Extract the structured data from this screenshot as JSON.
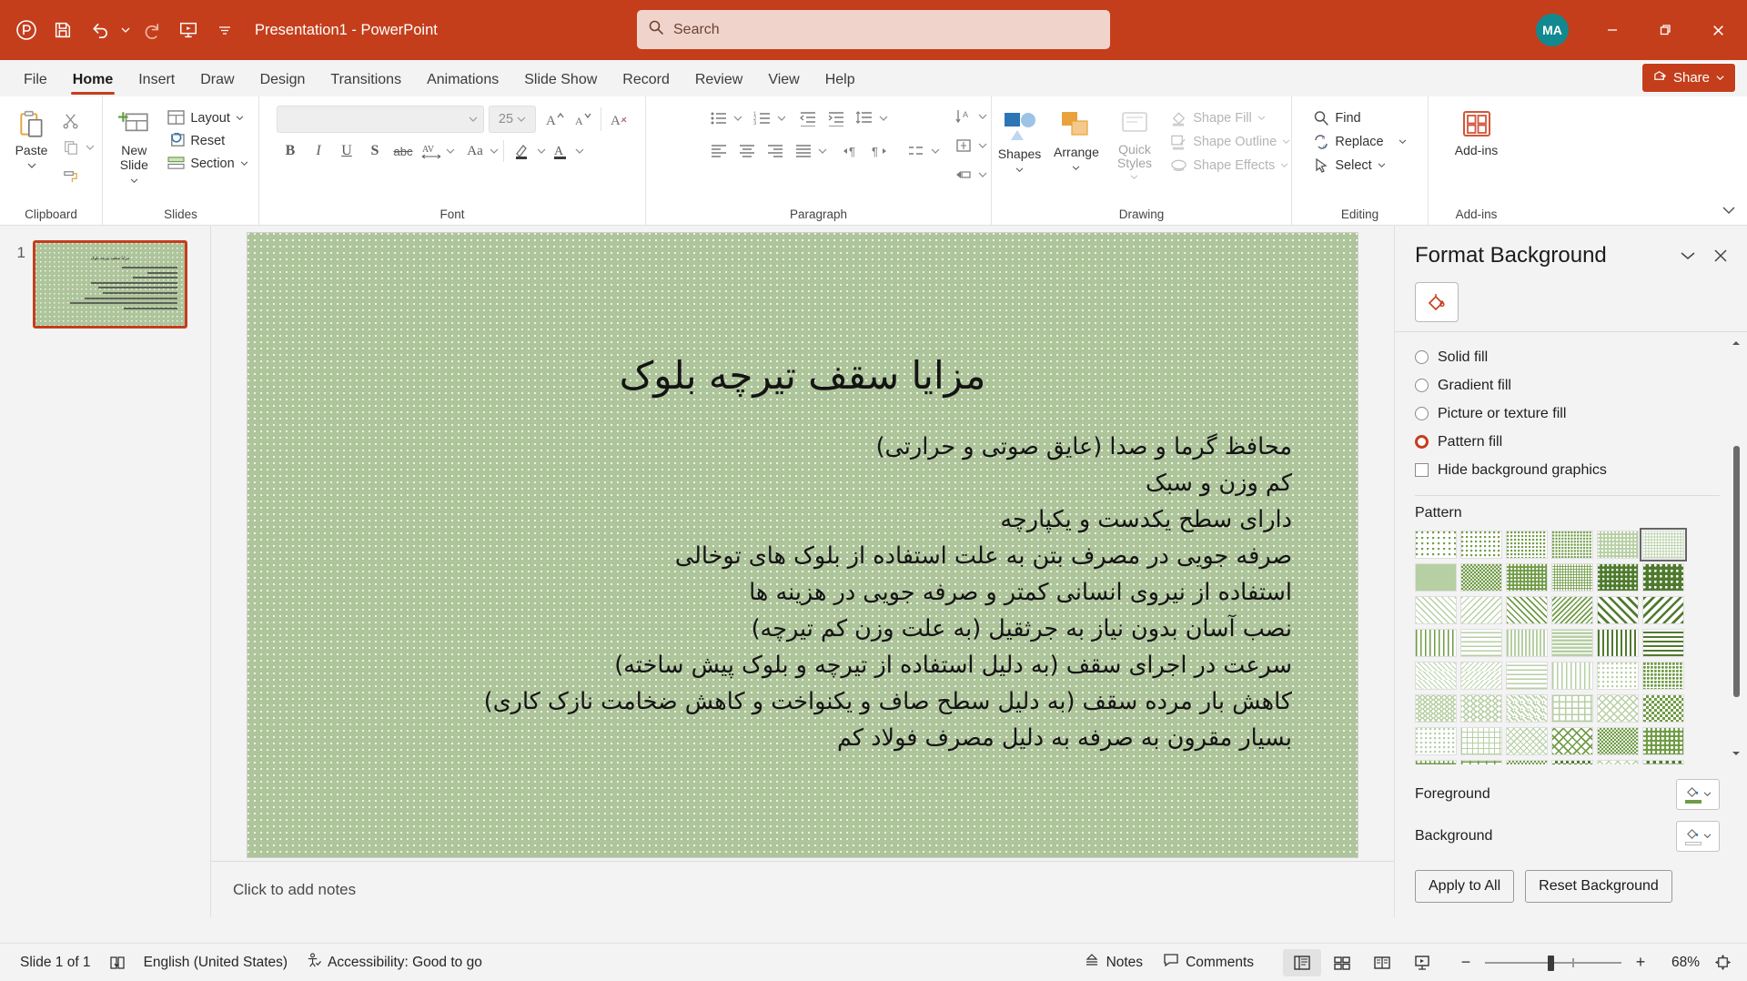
{
  "titlebar": {
    "app_title": "Presentation1  -  PowerPoint",
    "quick_access": [
      {
        "name": "powerpoint-logo-icon",
        "label": "PowerPoint"
      },
      {
        "name": "save-icon",
        "label": "Save"
      },
      {
        "name": "undo-icon",
        "label": "Undo"
      },
      {
        "name": "redo-icon",
        "label": "Redo"
      },
      {
        "name": "start-presentation-icon",
        "label": "Start From Beginning"
      },
      {
        "name": "customize-quick-access-toolbar-icon",
        "label": "Customize Quick Access Toolbar"
      }
    ],
    "search": {
      "placeholder": "Search",
      "icon": "search-icon"
    },
    "avatar_initials": "MA",
    "window_buttons": [
      {
        "name": "minimize-button",
        "glyph": "–"
      },
      {
        "name": "restore-button",
        "glyph": "❐"
      },
      {
        "name": "close-button",
        "glyph": "✕"
      }
    ],
    "accent_color": "#c43e1c"
  },
  "tabs": [
    {
      "label": "File",
      "active": false
    },
    {
      "label": "Home",
      "active": true
    },
    {
      "label": "Insert",
      "active": false
    },
    {
      "label": "Draw",
      "active": false
    },
    {
      "label": "Design",
      "active": false
    },
    {
      "label": "Transitions",
      "active": false
    },
    {
      "label": "Animations",
      "active": false
    },
    {
      "label": "Slide Show",
      "active": false
    },
    {
      "label": "Record",
      "active": false
    },
    {
      "label": "Review",
      "active": false
    },
    {
      "label": "View",
      "active": false
    },
    {
      "label": "Help",
      "active": false
    }
  ],
  "share_button": {
    "label": "Share"
  },
  "ribbon": {
    "groups": [
      {
        "name": "clipboard",
        "label": "Clipboard"
      },
      {
        "name": "slides",
        "label": "Slides"
      },
      {
        "name": "font",
        "label": "Font"
      },
      {
        "name": "paragraph",
        "label": "Paragraph"
      },
      {
        "name": "drawing",
        "label": "Drawing"
      },
      {
        "name": "editing",
        "label": "Editing"
      },
      {
        "name": "addins",
        "label": "Add-ins"
      }
    ],
    "clipboard": {
      "paste_label": "Paste",
      "cut_label": "Cut",
      "copy_label": "Copy",
      "format_painter_label": "Format Painter"
    },
    "slides": {
      "new_slide_label": "New\nSlide",
      "new_slide_line1": "New",
      "new_slide_line2": "Slide",
      "layout_label": "Layout",
      "reset_label": "Reset",
      "section_label": "Section"
    },
    "font": {
      "font_name_value": "",
      "font_size_value": "25",
      "bold": "B",
      "italic": "I",
      "underline": "U",
      "shadow": "S",
      "strikethrough": "abc",
      "char_spacing": "AV",
      "change_case": "Aa",
      "increase_font": "A",
      "decrease_font": "A",
      "clear_formatting": "A"
    },
    "drawing": {
      "shapes_label": "Shapes",
      "arrange_label": "Arrange",
      "quick_styles_label": "Quick\nStyles",
      "quick_styles_line1": "Quick",
      "quick_styles_line2": "Styles",
      "shape_fill_label": "Shape Fill",
      "shape_outline_label": "Shape Outline",
      "shape_effects_label": "Shape Effects"
    },
    "editing": {
      "find_label": "Find",
      "replace_label": "Replace",
      "select_label": "Select"
    },
    "addins": {
      "addins_label": "Add-ins"
    }
  },
  "thumbnails": [
    {
      "number": "1",
      "selected": true
    }
  ],
  "slide": {
    "title": "مزایا سقف تیرچه بلوک",
    "bullets": [
      "محافظ گرما و صدا (عایق صوتی و حرارتی)",
      "کم وزن و سبک",
      "دارای سطح یکدست و یکپارچه",
      "صرفه جویی در مصرف بتن به علت استفاده از بلوک های توخالی",
      "استفاده از نیروی انسانی کمتر و صرفه جویی در هزینه ها",
      "نصب آسان بدون نیاز به جرثقیل (به علت وزن کم تیرچه)",
      "سرعت در اجرای سقف (به دلیل استفاده از تیرچه و بلوک پیش ساخته)",
      "کاهش بار مرده سقف (به دلیل سطح صاف و یکنواخت و کاهش ضخامت نازک کاری)",
      "بسیار مقرون به صرفه به دلیل مصرف فولاد کم"
    ],
    "background_color": "#aec49b",
    "pattern_dot_color": "#eef2e6"
  },
  "notes": {
    "placeholder": "Click to add notes"
  },
  "format_background": {
    "title": "Format Background",
    "collapse_icon": "chevron-down-icon",
    "close_icon": "close-icon",
    "fill_tab_icon": "fill-bucket-icon",
    "fill_options": [
      {
        "label": "Solid fill",
        "accesskey": "S",
        "selected": false,
        "type": "radio"
      },
      {
        "label": "Gradient fill",
        "accesskey": "G",
        "selected": false,
        "type": "radio"
      },
      {
        "label": "Picture or texture fill",
        "accesskey": "P",
        "selected": false,
        "type": "radio"
      },
      {
        "label": "Pattern fill",
        "accesskey": "a",
        "selected": true,
        "type": "radio"
      },
      {
        "label": "Hide background graphics",
        "accesskey": "H",
        "selected": false,
        "type": "checkbox"
      }
    ],
    "pattern_section_label": "Pattern",
    "pattern_selected_index": 5,
    "pattern_grid": {
      "columns": 6,
      "rows": 8
    },
    "foreground_label": "Foreground",
    "background_label": "Background",
    "foreground_color": "#6f9b45",
    "background_color": "#ffffff",
    "apply_to_all_label": "Apply to All",
    "reset_background_label": "Reset Background"
  },
  "statusbar": {
    "slide_count": "Slide 1 of 1",
    "accessibility_check_icon": "book-icon",
    "language": "English (United States)",
    "accessibility": "Accessibility: Good to go",
    "notes_label": "Notes",
    "comments_label": "Comments",
    "views": [
      {
        "name": "normal-view-button",
        "active": true
      },
      {
        "name": "slide-sorter-view-button",
        "active": false
      },
      {
        "name": "reading-view-button",
        "active": false
      },
      {
        "name": "slide-show-button",
        "active": false
      }
    ],
    "zoom_level": "68%",
    "zoom_out": "−",
    "zoom_in": "+",
    "fit_to_window_icon": "fit-slide-icon"
  }
}
